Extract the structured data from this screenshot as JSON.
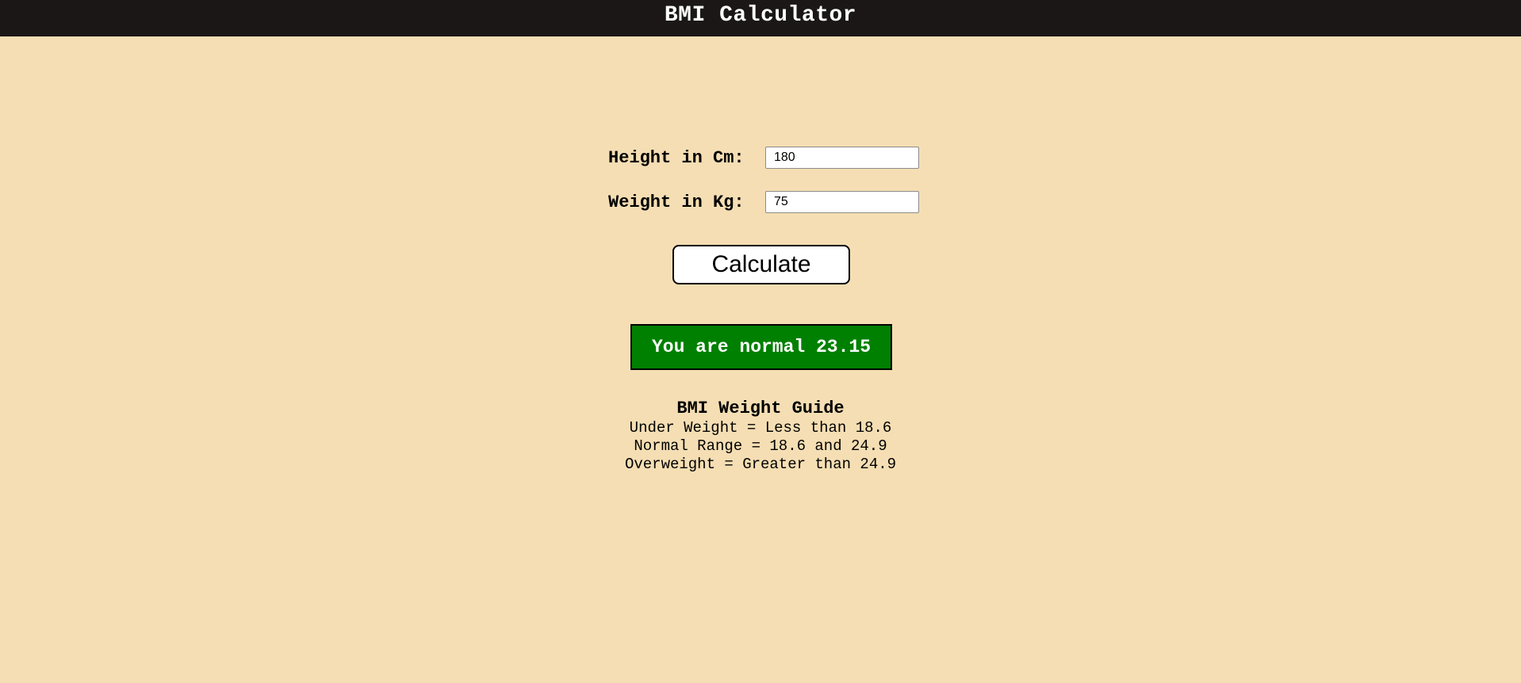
{
  "header": {
    "title": "BMI Calculator"
  },
  "form": {
    "height": {
      "label": "Height in Cm:",
      "value": "180"
    },
    "weight": {
      "label": "Weight in Kg:",
      "value": "75"
    },
    "calculate_label": "Calculate"
  },
  "result": {
    "text": "You are normal 23.15",
    "color": "#008000"
  },
  "guide": {
    "title": "BMI Weight Guide",
    "lines": [
      "Under Weight = Less than 18.6",
      "Normal Range = 18.6 and 24.9",
      "Overweight = Greater than 24.9"
    ]
  },
  "colors": {
    "background": "#f5deb3",
    "header": "#1b1717"
  }
}
